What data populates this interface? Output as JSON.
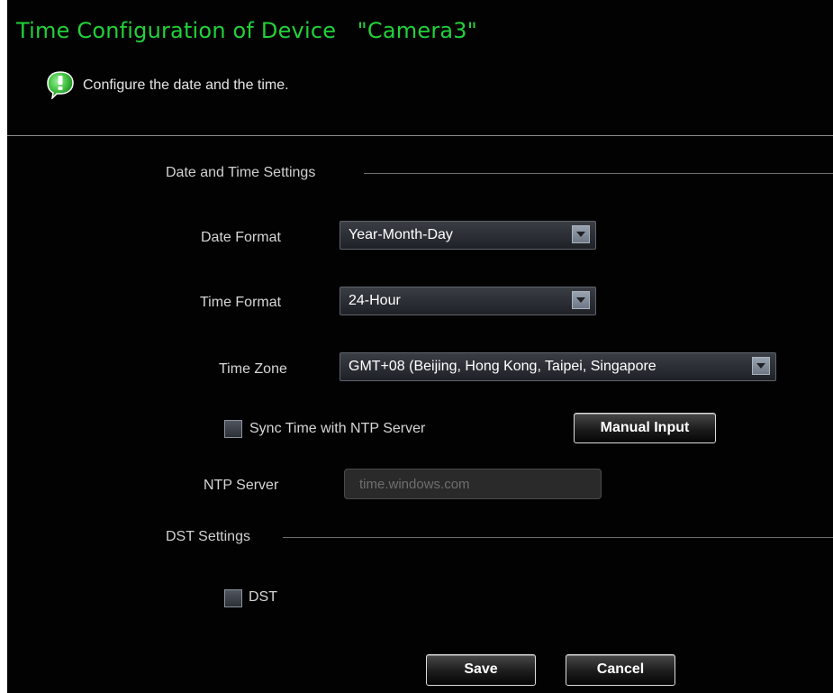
{
  "window": {
    "title": "Time Configuration of Device   \"Camera3\""
  },
  "hint": {
    "text": "Configure the date and the time."
  },
  "date_time": {
    "section_title": "Date and Time Settings",
    "date_format": {
      "label": "Date Format",
      "value": "Year-Month-Day"
    },
    "time_format": {
      "label": "Time Format",
      "value": "24-Hour"
    },
    "time_zone": {
      "label": "Time Zone",
      "value": "GMT+08 (Beijing, Hong Kong, Taipei, Singapore"
    },
    "ntp_sync": {
      "label": "Sync Time with NTP Server",
      "checked": false
    },
    "manual_input_label": "Manual Input",
    "ntp_server": {
      "label": "NTP Server",
      "placeholder": "time.windows.com"
    }
  },
  "dst": {
    "section_title": "DST Settings",
    "dst_checkbox": {
      "label": "DST",
      "checked": false
    }
  },
  "actions": {
    "save_label": "Save",
    "cancel_label": "Cancel"
  },
  "colors": {
    "title_green": "#22d13a",
    "background": "#020202",
    "icon_green": "#3bbd3b"
  }
}
